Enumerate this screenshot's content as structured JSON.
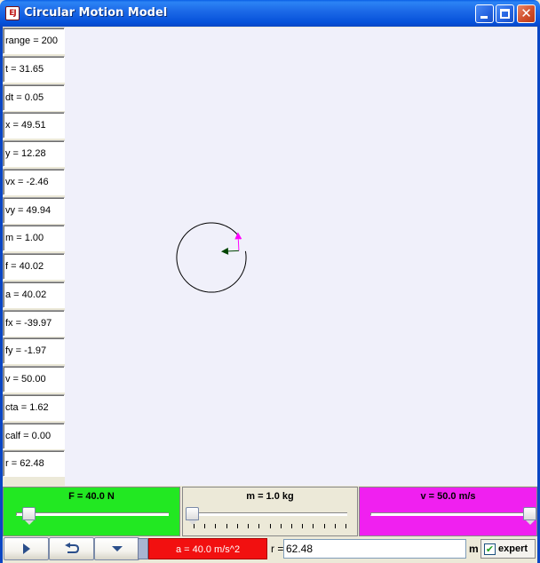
{
  "window": {
    "title": "Circular Motion Model",
    "icon_text": "EJ"
  },
  "readouts": [
    "range = 200",
    "t = 31.65",
    "dt = 0.05",
    "x = 49.51",
    "y = 12.28",
    "vx = -2.46",
    "vy = 49.94",
    "m = 1.00",
    "f = 40.02",
    "a = 40.02",
    "fx = -39.97",
    "fy = -1.97",
    "v = 50.00",
    "cta = 1.62",
    "calf = 0.00",
    "r = 62.48"
  ],
  "simulation": {
    "range": 200,
    "x": 49.51,
    "y": 12.28,
    "vx": -2.46,
    "vy": 49.94,
    "fx": -39.97,
    "fy": -1.97,
    "r": 62.48,
    "velocity_color": "#FF00FF",
    "force_color": "#004400"
  },
  "sliders": {
    "force": {
      "label": "F = 40.0 N",
      "fraction": 0.08,
      "color": "#22E822",
      "ticks": 0
    },
    "mass": {
      "label": "m = 1.0 kg",
      "fraction": 0.0,
      "color": "#ECE9D8",
      "ticks": 15
    },
    "velocity": {
      "label": "v = 50.0 m/s",
      "fraction": 1.0,
      "color": "#F020F0",
      "ticks": 0
    }
  },
  "controls": {
    "play_icon": "play-icon",
    "reset_icon": "reset-icon",
    "step_icon": "dropdown-triangle-icon",
    "status": "a = 40.0 m/s^2",
    "r_label": "r =",
    "r_value": "62.48",
    "r_unit": "m",
    "expert_label": "expert",
    "expert_checked": true
  }
}
